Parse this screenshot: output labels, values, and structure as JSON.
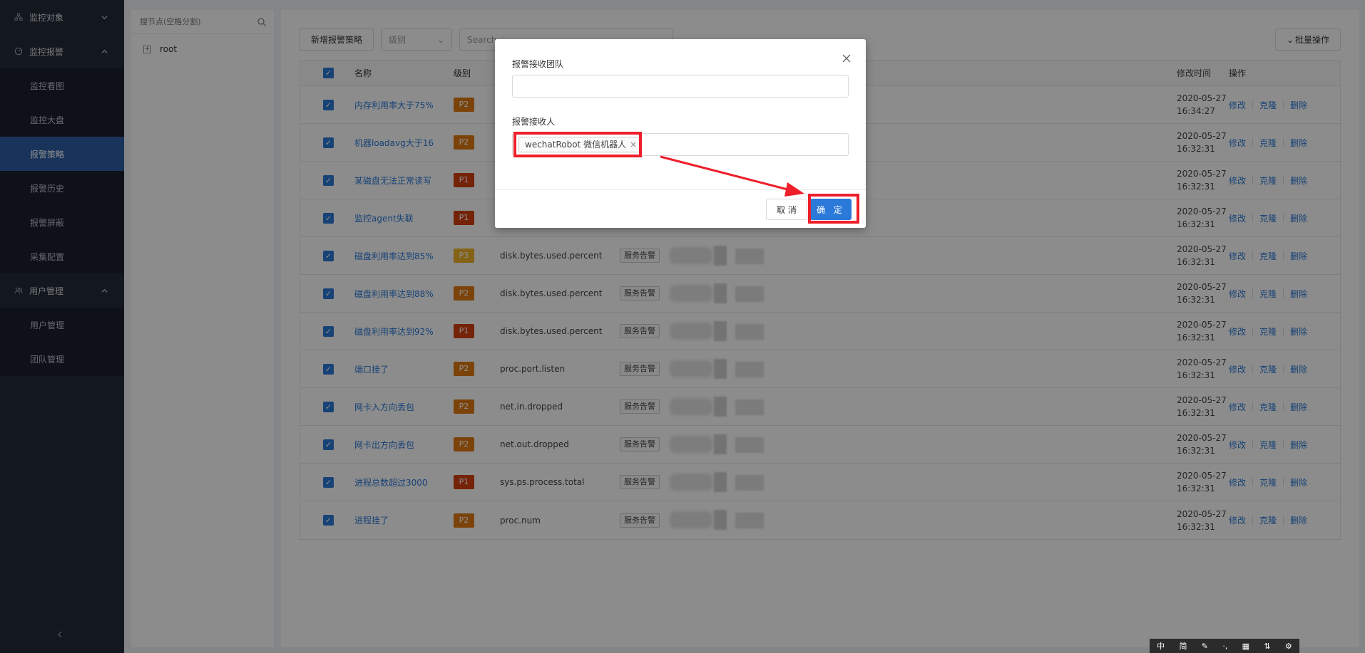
{
  "sidebar": {
    "groups": [
      {
        "label": "监控对象",
        "icon": "hierarchy-icon",
        "expanded": false,
        "items": []
      },
      {
        "label": "监控报警",
        "icon": "dashboard-icon",
        "expanded": true,
        "items": [
          "监控看图",
          "监控大盘",
          "报警策略",
          "报警历史",
          "报警屏蔽",
          "采集配置"
        ]
      },
      {
        "label": "用户管理",
        "icon": "users-icon",
        "expanded": true,
        "items": [
          "用户管理",
          "团队管理"
        ]
      }
    ],
    "active_item": "报警策略",
    "collapse_icon": "chevron-left-icon"
  },
  "tree": {
    "search_placeholder": "搜节点(空格分割)",
    "nodes": [
      {
        "label": "root"
      }
    ]
  },
  "toolbar": {
    "add_label": "新增报警策略",
    "level_placeholder": "级别",
    "search_placeholder": "Search",
    "batch_label": "批量操作"
  },
  "table": {
    "headers": {
      "name": "名称",
      "level": "级别",
      "modified": "修改时间",
      "ops": "操作"
    },
    "op_labels": [
      "修改",
      "克隆",
      "删除"
    ],
    "rows": [
      {
        "name": "内存利用率大于75%",
        "level": "P2",
        "metric": "",
        "tag": "",
        "time": [
          "2020-05-27",
          "16:34:27"
        ]
      },
      {
        "name": "机器loadavg大于16",
        "level": "P2",
        "metric": "",
        "tag": "",
        "time": [
          "2020-05-27",
          "16:32:31"
        ]
      },
      {
        "name": "某磁盘无法正常读写",
        "level": "P1",
        "metric": "",
        "tag": "",
        "time": [
          "2020-05-27",
          "16:32:31"
        ]
      },
      {
        "name": "监控agent失联",
        "level": "P1",
        "metric": "",
        "tag": "",
        "time": [
          "2020-05-27",
          "16:32:31"
        ]
      },
      {
        "name": "磁盘利用率达到85%",
        "level": "P3",
        "metric": "disk.bytes.used.percent",
        "tag": "服务告警",
        "time": [
          "2020-05-27",
          "16:32:31"
        ]
      },
      {
        "name": "磁盘利用率达到88%",
        "level": "P2",
        "metric": "disk.bytes.used.percent",
        "tag": "服务告警",
        "time": [
          "2020-05-27",
          "16:32:31"
        ]
      },
      {
        "name": "磁盘利用率达到92%",
        "level": "P1",
        "metric": "disk.bytes.used.percent",
        "tag": "服务告警",
        "time": [
          "2020-05-27",
          "16:32:31"
        ]
      },
      {
        "name": "端口挂了",
        "level": "P2",
        "metric": "proc.port.listen",
        "tag": "服务告警",
        "time": [
          "2020-05-27",
          "16:32:31"
        ]
      },
      {
        "name": "网卡入方向丢包",
        "level": "P2",
        "metric": "net.in.dropped",
        "tag": "服务告警",
        "time": [
          "2020-05-27",
          "16:32:31"
        ]
      },
      {
        "name": "网卡出方向丢包",
        "level": "P2",
        "metric": "net.out.dropped",
        "tag": "服务告警",
        "time": [
          "2020-05-27",
          "16:32:31"
        ]
      },
      {
        "name": "进程总数超过3000",
        "level": "P1",
        "metric": "sys.ps.process.total",
        "tag": "服务告警",
        "time": [
          "2020-05-27",
          "16:32:31"
        ]
      },
      {
        "name": "进程挂了",
        "level": "P2",
        "metric": "proc.num",
        "tag": "服务告警",
        "time": [
          "2020-05-27",
          "16:32:31"
        ]
      }
    ]
  },
  "level_colors": {
    "P1": "#d4400f",
    "P2": "#e07b12",
    "P3": "#f0b429"
  },
  "modal": {
    "team_label": "报警接收团队",
    "team_value": "",
    "receiver_label": "报警接收人",
    "receiver_tags": [
      "wechatRobot 微信机器人"
    ],
    "cancel_label": "取 消",
    "ok_label": "确 定"
  },
  "ime": {
    "items": [
      "中",
      "简",
      "✎",
      "·,",
      "▦",
      "⇅",
      "⚙"
    ]
  },
  "colors": {
    "accent": "#2b79d8",
    "annotation": "#ee1f2b",
    "sidebar_bg": "#232a38"
  }
}
